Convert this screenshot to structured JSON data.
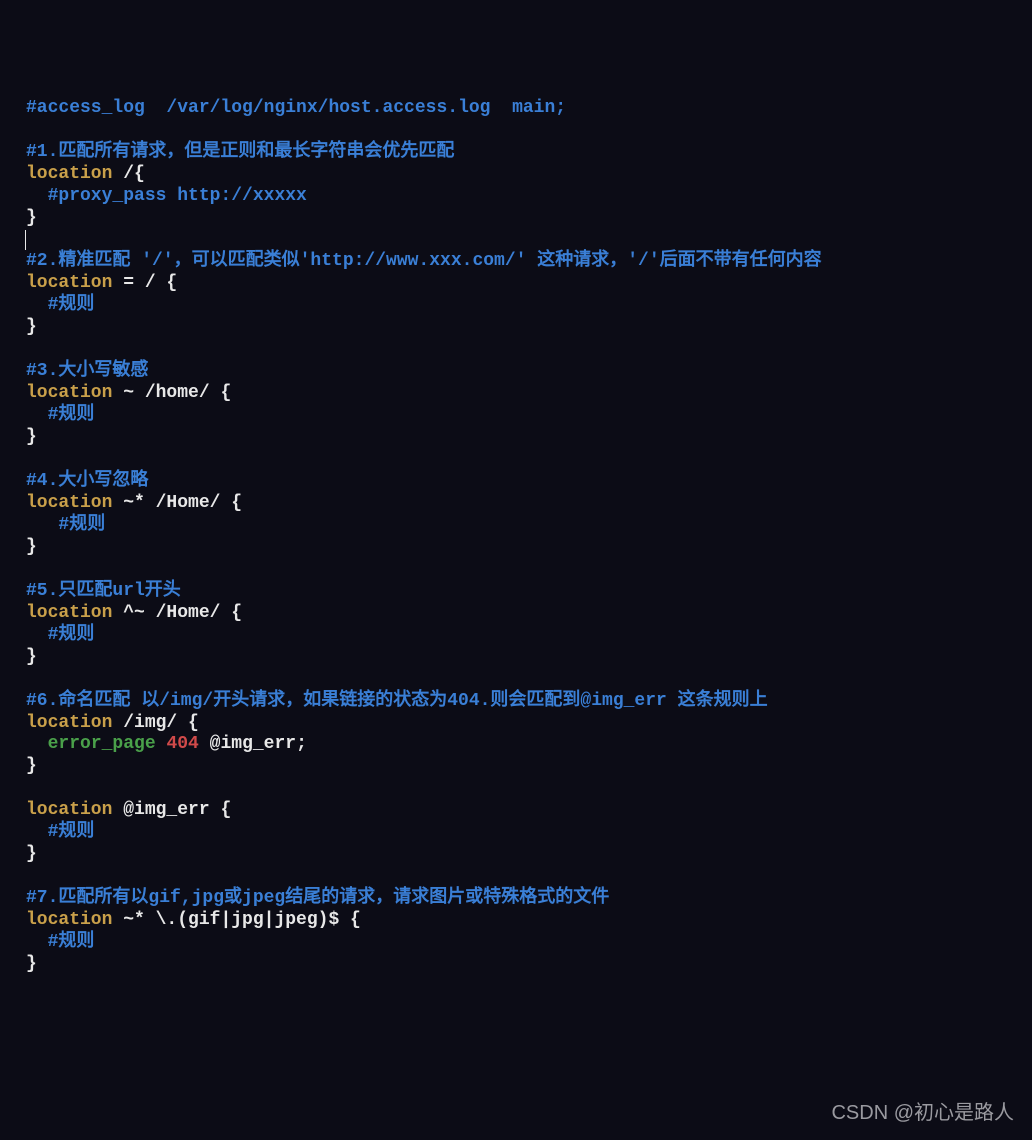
{
  "code": {
    "c_access": "#access_log  /var/log/nginx/host.access.log  main;",
    "c1": "#1.匹配所有请求，但是正则和最长字符串会优先匹配",
    "loc1_kw": "location",
    "loc1_rest": " /{",
    "loc1_body": "  #proxy_pass http://xxxxx",
    "brace": "}",
    "c2": "#2.精准匹配 '/'，可以匹配类似'http://www.xxx.com/' 这种请求，'/'后面不带有任何内容",
    "loc2_kw": "location",
    "loc2_rest": " = / {",
    "rule_indent2": "  #规则",
    "c3": "#3.大小写敏感",
    "loc3_kw": "location",
    "loc3_rest": " ~ /home/ {",
    "c4": "#4.大小写忽略",
    "loc4_kw": "location",
    "loc4_rest": " ~* /Home/ {",
    "rule_indent3": "   #规则",
    "c5": "#5.只匹配url开头",
    "loc5_kw": "location",
    "loc5_rest": " ^~ /Home/ {",
    "c6": "#6.命名匹配 以/img/开头请求，如果链接的状态为404.则会匹配到@img_err 这条规则上",
    "loc6_kw": "location",
    "loc6_rest": " /img/ {",
    "err_indent": "  ",
    "err_dir": "error_page",
    "err_sp": " ",
    "err_code": "404",
    "err_rest": " @img_err;",
    "loc6b_kw": "location",
    "loc6b_rest": " @img_err {",
    "c7": "#7.匹配所有以gif,jpg或jpeg结尾的请求，请求图片或特殊格式的文件",
    "loc7_kw": "location",
    "loc7_rest": " ~* \\.(gif|jpg|jpeg)$ {"
  },
  "watermark": "CSDN @初心是路人"
}
